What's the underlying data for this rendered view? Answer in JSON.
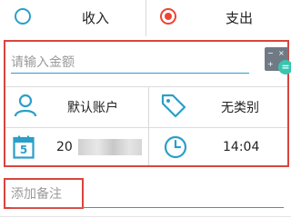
{
  "type_selector": {
    "income_label": "收入",
    "expense_label": "支出",
    "selected": "expense",
    "colors": {
      "income_radio": "#2a9fc9",
      "expense_radio": "#ee4433"
    }
  },
  "amount": {
    "placeholder": "请输入金额",
    "value": "",
    "keypad_icon": "calculator-icon",
    "keypad_symbols": [
      "−",
      "×",
      "+",
      "="
    ]
  },
  "account": {
    "icon": "person-icon",
    "label": "默认账户"
  },
  "category": {
    "icon": "tag-icon",
    "label": "无类别"
  },
  "date": {
    "icon": "calendar-icon",
    "calendar_day": "5",
    "label": "20"
  },
  "time": {
    "icon": "clock-icon",
    "label": "14:04"
  },
  "note": {
    "placeholder": "添加备注",
    "value": ""
  },
  "colors": {
    "accent": "#2a9fc9",
    "highlight_border": "#d9443c"
  }
}
